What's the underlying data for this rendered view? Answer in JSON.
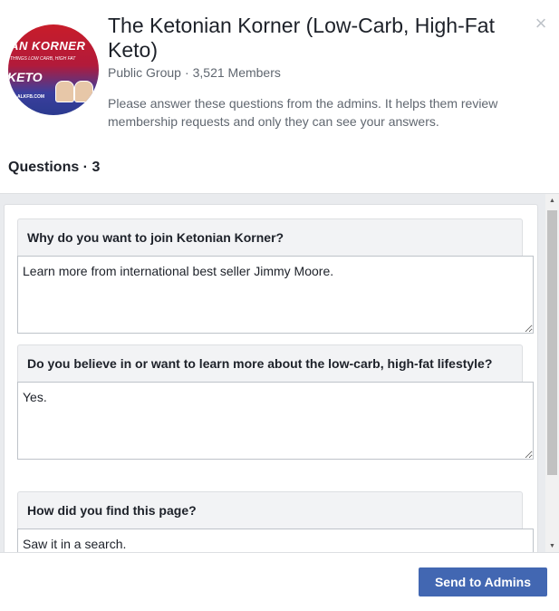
{
  "group": {
    "name": "The Ketonian Korner (Low-Carb, High-Fat Keto)",
    "privacy": "Public Group",
    "separator": "·",
    "members": "3,521 Members",
    "instructions": "Please answer these questions from the admins. It helps them review membership requests and only they can see your answers.",
    "avatar": {
      "line1": "IAN KORNER",
      "line2": "THINGS LOW CARB, HIGH FAT",
      "line3": "KETO",
      "line4": "ALKFB.COM"
    }
  },
  "close_icon": "close-icon",
  "close_glyph": "×",
  "questions_header": "Questions · 3",
  "questions": [
    {
      "label": "Why do you want to join Ketonian Korner?",
      "answer": "Learn more from international best seller Jimmy Moore."
    },
    {
      "label": "Do you believe in or want to learn more about the low-carb, high-fat lifestyle?",
      "answer": "Yes."
    },
    {
      "label": "How did you find this page?",
      "answer": "Saw it in a search."
    }
  ],
  "footer": {
    "send_label": "Send to Admins"
  },
  "colors": {
    "brand_blue": "#4267b2",
    "muted_text": "#606770",
    "panel_bg": "#e9ebee"
  }
}
